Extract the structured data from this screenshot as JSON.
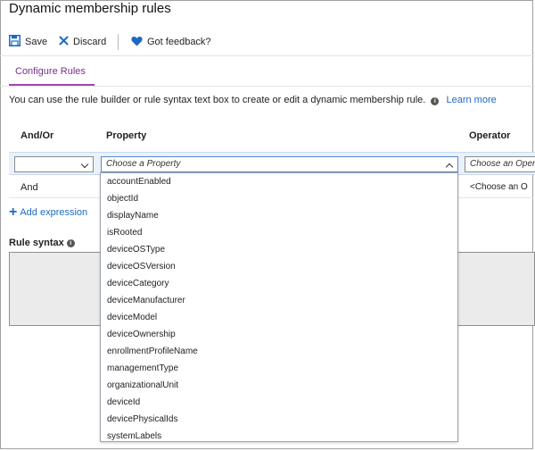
{
  "title": "Dynamic membership rules",
  "toolbar": {
    "save_label": "Save",
    "discard_label": "Discard",
    "feedback_label": "Got feedback?"
  },
  "tabs": [
    {
      "label": "Configure Rules",
      "active": true
    }
  ],
  "info": {
    "text": "You can use the rule builder or rule syntax text box to create or edit a dynamic membership rule.",
    "learn_more": "Learn more"
  },
  "table": {
    "headers": {
      "and_or": "And/Or",
      "property": "Property",
      "operator": "Operator"
    },
    "row1": {
      "and_or_value": "",
      "property_placeholder": "Choose a Property",
      "operator_placeholder": "Choose an Oper"
    },
    "row2": {
      "and_or": "And",
      "operator": "<Choose an O"
    }
  },
  "add_expression_label": "Add expression",
  "rule_syntax_label": "Rule syntax",
  "property_options": [
    "accountEnabled",
    "objectId",
    "displayName",
    "isRooted",
    "deviceOSType",
    "deviceOSVersion",
    "deviceCategory",
    "deviceManufacturer",
    "deviceModel",
    "deviceOwnership",
    "enrollmentProfileName",
    "managementType",
    "organizationalUnit",
    "deviceId",
    "devicePhysicalIds",
    "systemLabels"
  ],
  "colors": {
    "accent_purple": "#7a2e8c",
    "link_blue": "#1d6ac4",
    "heart_blue": "#1d6ac4",
    "selected_row_bg": "#eaf1fb"
  }
}
